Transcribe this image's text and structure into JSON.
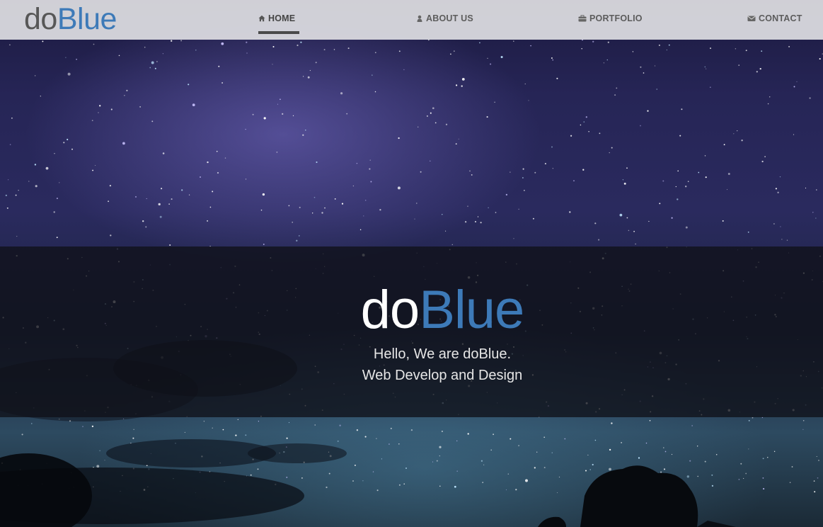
{
  "brand": {
    "name_part1": "do",
    "name_part2": "Blue"
  },
  "nav": {
    "items": [
      {
        "label": "HOME",
        "icon": "home-icon",
        "active": true
      },
      {
        "label": "ABOUT US",
        "icon": "user-icon",
        "active": false
      },
      {
        "label": "PORTFOLIO",
        "icon": "briefcase-icon",
        "active": false
      },
      {
        "label": "CONTACT",
        "icon": "envelope-icon",
        "active": false
      }
    ]
  },
  "hero": {
    "title_part1": "do",
    "title_part2": "Blue",
    "line1": "Hello, We are doBlue.",
    "line2": "Web Develop and Design"
  },
  "colors": {
    "accent": "#3d7ab8",
    "nav_background": "#dededd",
    "nav_text": "#5c5c5c",
    "hero_band": "#0f1118"
  }
}
